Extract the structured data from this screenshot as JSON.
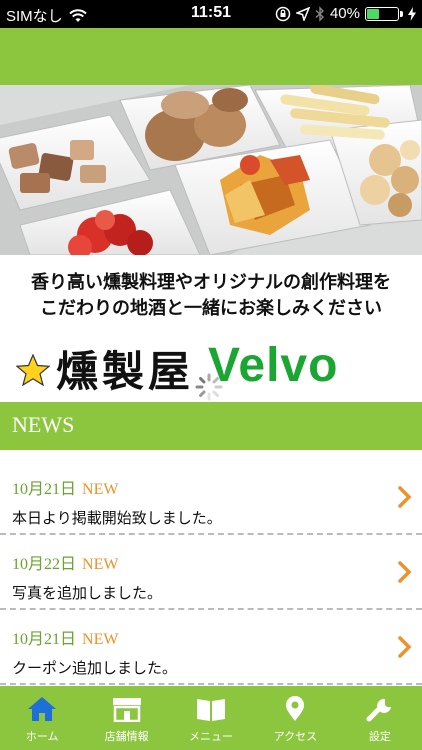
{
  "status": {
    "carrier": "SIMなし",
    "time": "11:51",
    "battery_text": "40%",
    "battery_level": 0.4
  },
  "tagline": {
    "line1": "香り高い燻製料理やオリジナルの創作料理を",
    "line2": "こだわりの地酒と一緒にお楽しみください"
  },
  "logo": {
    "jp": "燻製屋",
    "en": "Velvo"
  },
  "news": {
    "title": "NEWS",
    "items": [
      {
        "date": "10月21日",
        "badge": "NEW",
        "text": "本日より掲載開始致しました。"
      },
      {
        "date": "10月22日",
        "badge": "NEW",
        "text": "写真を追加しました。"
      },
      {
        "date": "10月21日",
        "badge": "NEW",
        "text": "クーポン追加しました。"
      }
    ]
  },
  "tabs": [
    {
      "label": "ホーム",
      "icon": "home-icon"
    },
    {
      "label": "店舗情報",
      "icon": "store-icon"
    },
    {
      "label": "メニュー",
      "icon": "book-icon"
    },
    {
      "label": "アクセス",
      "icon": "map-pin-icon"
    },
    {
      "label": "設定",
      "icon": "wrench-icon"
    }
  ],
  "colors": {
    "accent": "#8cc63f",
    "logo_green": "#1aa631",
    "new_badge": "#f0902a",
    "active_tab": "#1e6fd9"
  }
}
